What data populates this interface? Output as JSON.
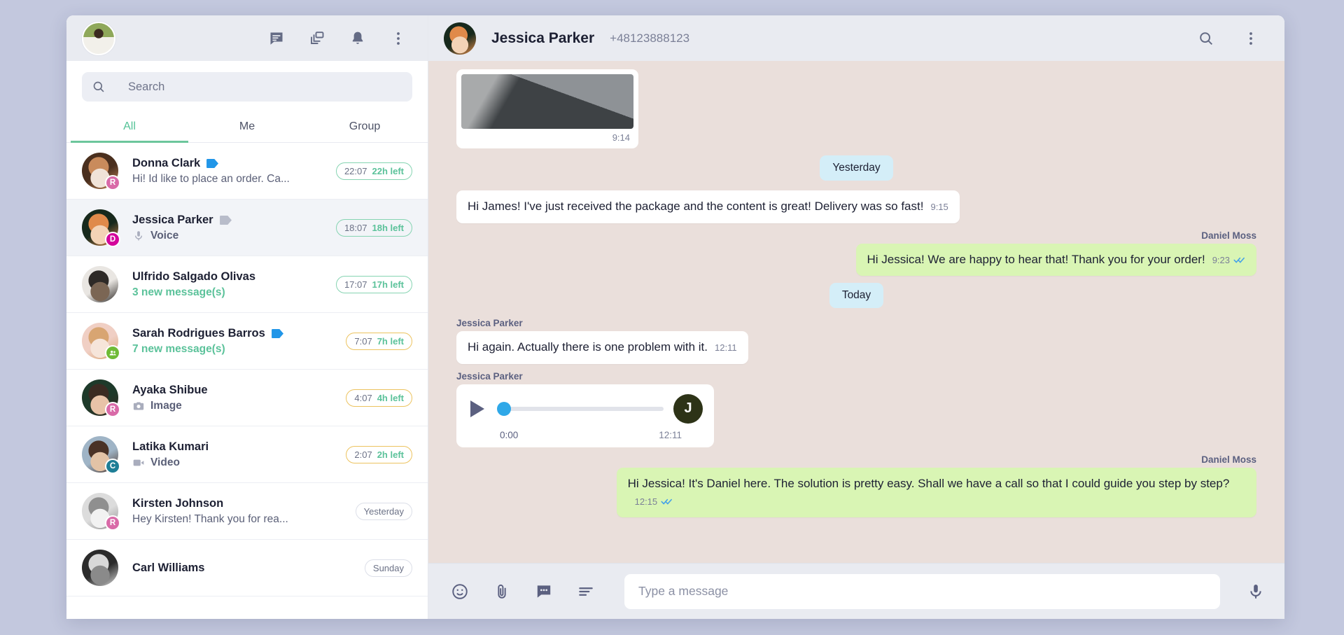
{
  "sidebar": {
    "header": {
      "avatar_name": "user-avatar",
      "icons": [
        {
          "name": "chat-icon",
          "label": "Chats"
        },
        {
          "name": "layers-icon",
          "label": "Templates"
        },
        {
          "name": "bell-icon",
          "label": "Notifications"
        },
        {
          "name": "more-vertical-icon",
          "label": "More"
        }
      ]
    },
    "search": {
      "placeholder": "Search",
      "value": ""
    },
    "tabs": [
      {
        "label": "All",
        "active": true
      },
      {
        "label": "Me",
        "active": false
      },
      {
        "label": "Group",
        "active": false
      }
    ],
    "conversations": [
      {
        "name": "Donna Clark",
        "preview": "Hi! Id like to place an order. Ca...",
        "preview_icon": "",
        "unread": false,
        "flag_color": "#2196e8",
        "badge": {
          "letter": "R",
          "color": "#d96aa8"
        },
        "time": "22:07",
        "left": "22h left",
        "pill_style": "green",
        "selected": false,
        "avatar_colors": [
          "#4a2f1e",
          "#c98b5c",
          "#f0e3d8"
        ]
      },
      {
        "name": "Jessica Parker",
        "preview": "Voice",
        "preview_icon": "mic-icon",
        "unread": false,
        "flag_color": "#b8bcca",
        "badge": {
          "letter": "D",
          "color": "#d4069b"
        },
        "time": "18:07",
        "left": "18h left",
        "pill_style": "green",
        "selected": true,
        "avatar_colors": [
          "#17291c",
          "#e08a4a",
          "#f3d3b6"
        ]
      },
      {
        "name": "Ulfrido Salgado Olivas",
        "preview": "3 new message(s)",
        "preview_icon": "",
        "unread": true,
        "flag_color": "",
        "badge": null,
        "time": "17:07",
        "left": "17h left",
        "pill_style": "green",
        "selected": false,
        "avatar_colors": [
          "#e9e6e2",
          "#2e2a27",
          "#7b6654"
        ]
      },
      {
        "name": "Sarah Rodrigues Barros",
        "preview": "7 new message(s)",
        "preview_icon": "",
        "unread": true,
        "flag_color": "#2196e8",
        "badge": {
          "letter": "\u0000group",
          "color": "#6fbb36"
        },
        "time": "7:07",
        "left": "7h left",
        "pill_style": "amber",
        "selected": false,
        "avatar_colors": [
          "#f0cfc4",
          "#d8a572",
          "#f6e5da"
        ]
      },
      {
        "name": "Ayaka Shibue",
        "preview": "Image",
        "preview_icon": "camera-icon",
        "unread": false,
        "flag_color": "",
        "badge": {
          "letter": "R",
          "color": "#d96aa8"
        },
        "time": "4:07",
        "left": "4h left",
        "pill_style": "amber",
        "selected": false,
        "avatar_colors": [
          "#1e3a2a",
          "#3b2b22",
          "#e8c3a8"
        ]
      },
      {
        "name": "Latika Kumari",
        "preview": "Video",
        "preview_icon": "video-icon",
        "unread": false,
        "flag_color": "",
        "badge": {
          "letter": "C",
          "color": "#1d7e96"
        },
        "time": "2:07",
        "left": "2h left",
        "pill_style": "amber",
        "selected": false,
        "avatar_colors": [
          "#9fb4c6",
          "#4a3226",
          "#e3c3a6"
        ]
      },
      {
        "name": "Kirsten Johnson",
        "preview": "Hey Kirsten! Thank you for rea...",
        "preview_icon": "",
        "unread": false,
        "flag_color": "",
        "badge": {
          "letter": "R",
          "color": "#d96aa8"
        },
        "time": "Yesterday",
        "left": "",
        "pill_style": "grey",
        "selected": false,
        "avatar_colors": [
          "#dcdcdc",
          "#8f8f8f",
          "#f2f2f2"
        ]
      },
      {
        "name": "Carl Williams",
        "preview": "",
        "preview_icon": "",
        "unread": false,
        "flag_color": "",
        "badge": null,
        "time": "Sunday",
        "left": "",
        "pill_style": "grey",
        "selected": false,
        "avatar_colors": [
          "#2b2b2b",
          "#d8d8d8",
          "#8a8a8a"
        ]
      }
    ]
  },
  "chat": {
    "contact_name": "Jessica Parker",
    "phone": "+48123888123",
    "icons": [
      {
        "name": "search-icon",
        "label": "Search in chat"
      },
      {
        "name": "more-vertical-icon",
        "label": "More"
      }
    ],
    "messages": [
      {
        "type": "image",
        "direction": "in",
        "sender": "",
        "time": "9:14"
      },
      {
        "type": "date",
        "label": "Yesterday"
      },
      {
        "type": "text",
        "direction": "in",
        "sender": "",
        "text": "Hi James! I've just received the package and the content is great! Delivery was so fast!",
        "time": "9:15"
      },
      {
        "type": "text",
        "direction": "out",
        "sender": "Daniel Moss",
        "text": "Hi Jessica! We are happy to hear that! Thank you for your order!",
        "time": "9:23",
        "ticks": true
      },
      {
        "type": "date",
        "label": "Today"
      },
      {
        "type": "text",
        "direction": "in",
        "sender": "Jessica Parker",
        "text": "Hi again. Actually there is one problem with it.",
        "time": "12:11"
      },
      {
        "type": "voice",
        "direction": "in",
        "sender": "Jessica Parker",
        "current_time": "0:00",
        "duration": "12:11",
        "avatar_letter": "J",
        "progress_percent": 0
      },
      {
        "type": "text",
        "direction": "out",
        "sender": "Daniel Moss",
        "text": "Hi Jessica! It's Daniel here. The solution is pretty easy. Shall we have a call so that I could guide you step by step?",
        "time": "12:15",
        "ticks": true
      }
    ],
    "composer": {
      "placeholder": "Type a message",
      "value": "",
      "icons": [
        {
          "name": "emoji-icon",
          "label": "Emoji"
        },
        {
          "name": "attachment-icon",
          "label": "Attach"
        },
        {
          "name": "quick-reply-icon",
          "label": "Quick replies"
        },
        {
          "name": "template-icon",
          "label": "Templates"
        }
      ],
      "mic": {
        "name": "microphone-icon",
        "label": "Record voice"
      }
    }
  },
  "colors": {
    "accent_green": "#5bc29a",
    "bubble_out": "#d9f5b4",
    "chat_bg": "#eadfdb",
    "header_bg": "#e9ebf1",
    "date_pill": "#d4eef8",
    "tick_blue": "#46a2e8"
  }
}
